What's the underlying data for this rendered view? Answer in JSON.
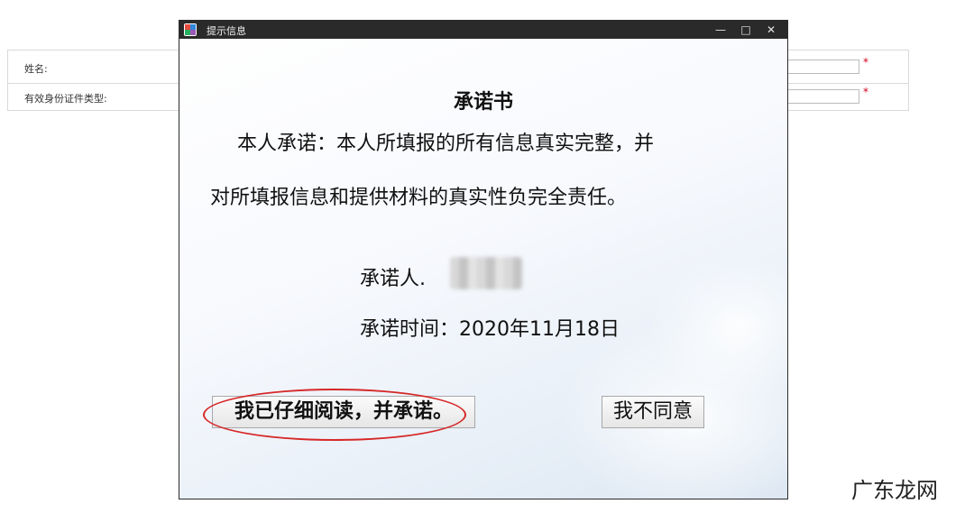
{
  "form": {
    "fields": [
      {
        "label": "姓名:",
        "required_mark": "*"
      },
      {
        "label": "有效身份证件类型:",
        "required_mark": "*"
      }
    ]
  },
  "dialog": {
    "title": "提示信息",
    "controls": {
      "minimize": "—",
      "maximize": "□",
      "close": "✕"
    },
    "heading": "承诺书",
    "paragraph_line1": "本人承诺：本人所填报的所有信息真实完整，并",
    "paragraph_line2": "对所填报信息和提供材料的真实性负完全责任。",
    "signer_label": "承诺人.",
    "time_label": "承诺时间：2020年11月18日",
    "agree_button": "我已仔细阅读，并承诺。",
    "disagree_button": "我不同意"
  },
  "watermark": "广东龙网",
  "colors": {
    "titlebar": "#2a2a2a",
    "highlight": "#d62828",
    "required": "#d0021b"
  }
}
